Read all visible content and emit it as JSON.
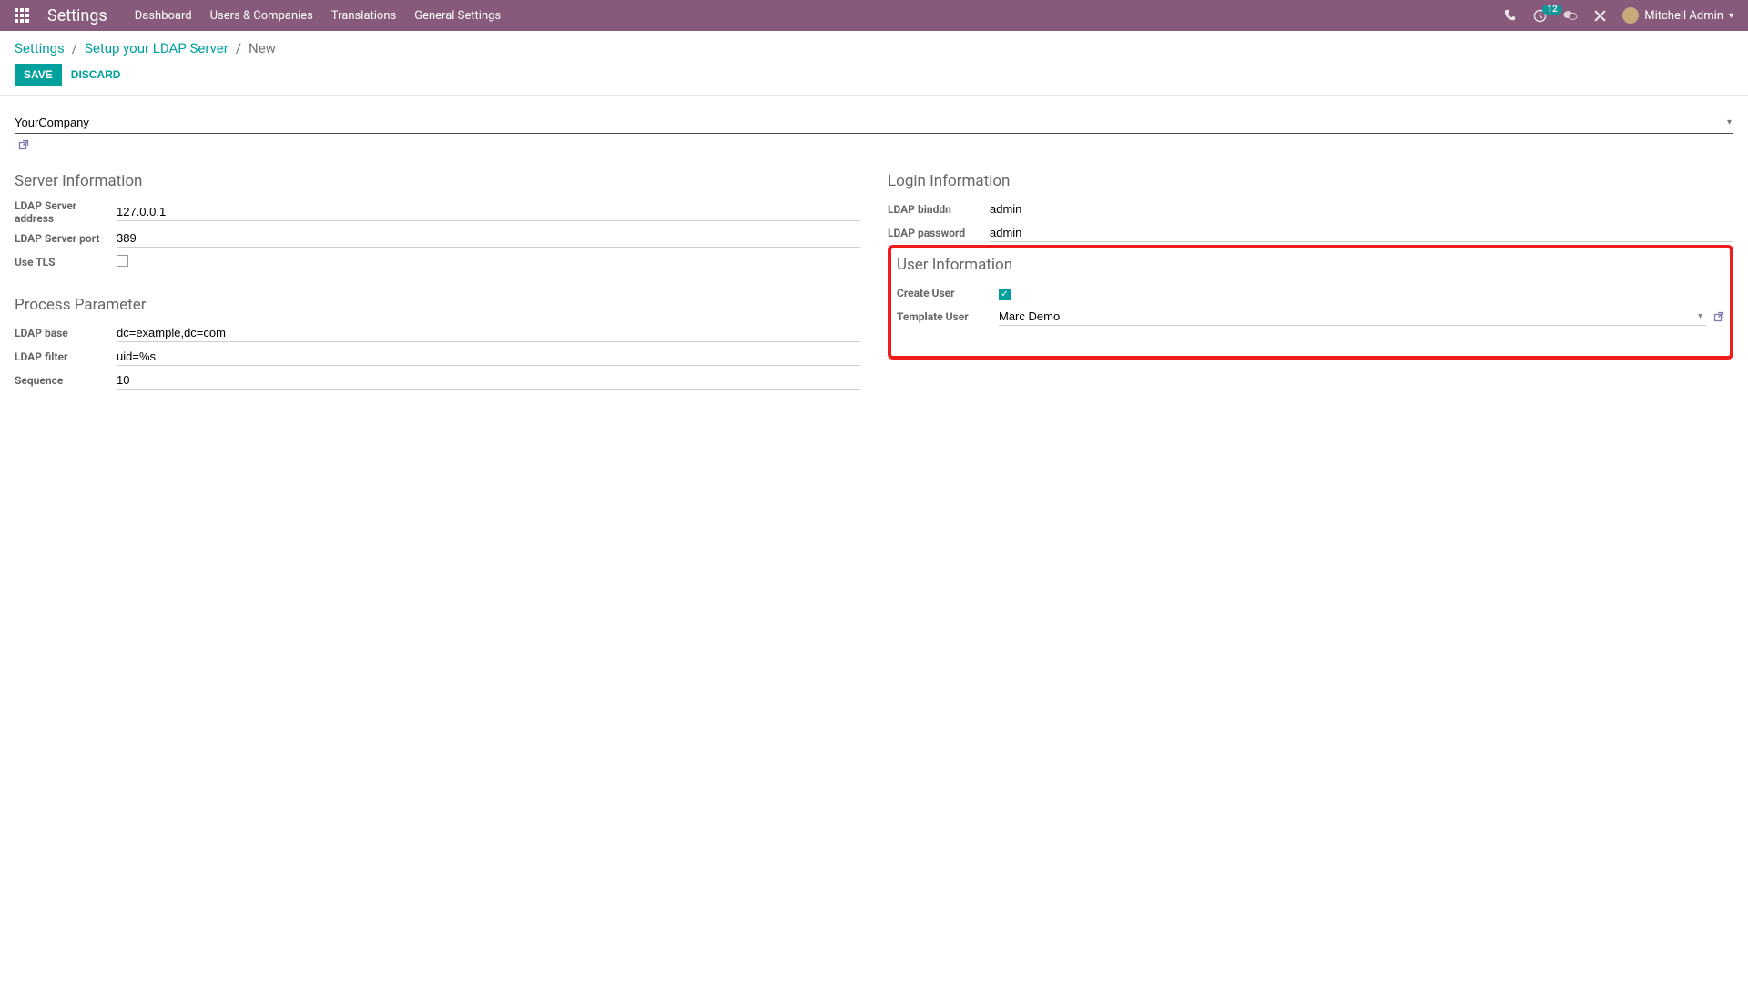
{
  "navbar": {
    "brand": "Settings",
    "menu": [
      "Dashboard",
      "Users & Companies",
      "Translations",
      "General Settings"
    ],
    "activity_count": "12",
    "user_name": "Mitchell Admin"
  },
  "breadcrumb": {
    "root": "Settings",
    "middle": "Setup your LDAP Server",
    "current": "New"
  },
  "buttons": {
    "save": "SAVE",
    "discard": "DISCARD"
  },
  "company": {
    "value": "YourCompany"
  },
  "sections": {
    "server_title": "Server Information",
    "process_title": "Process Parameter",
    "login_title": "Login Information",
    "user_title": "User Information"
  },
  "fields": {
    "ldap_server_addr_label": "LDAP Server address",
    "ldap_server_addr_value": "127.0.0.1",
    "ldap_server_port_label": "LDAP Server port",
    "ldap_server_port_value": "389",
    "use_tls_label": "Use TLS",
    "ldap_base_label": "LDAP base",
    "ldap_base_value": "dc=example,dc=com",
    "ldap_filter_label": "LDAP filter",
    "ldap_filter_value": "uid=%s",
    "sequence_label": "Sequence",
    "sequence_value": "10",
    "ldap_binddn_label": "LDAP binddn",
    "ldap_binddn_value": "admin",
    "ldap_password_label": "LDAP password",
    "ldap_password_value": "admin",
    "create_user_label": "Create User",
    "template_user_label": "Template User",
    "template_user_value": "Marc Demo"
  }
}
